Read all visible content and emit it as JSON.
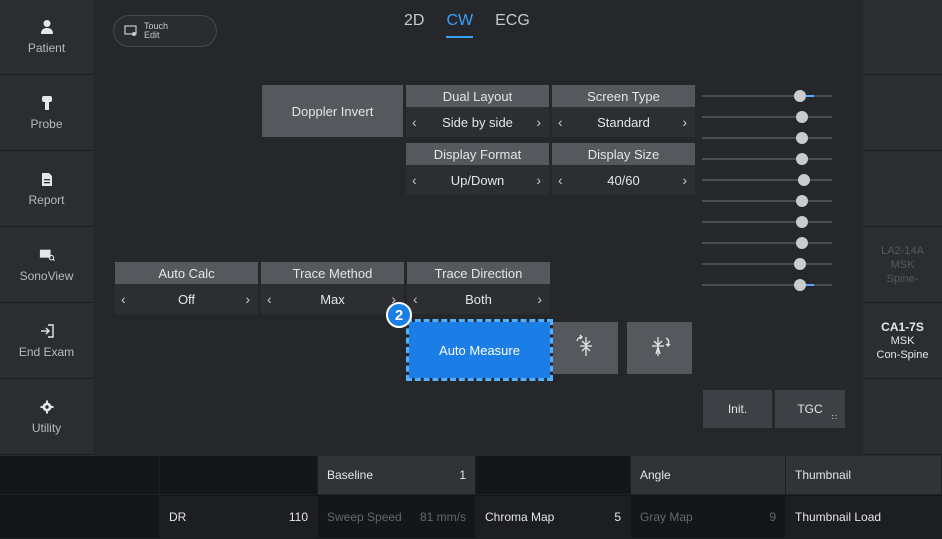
{
  "sidebar": {
    "items": [
      {
        "label": "Patient",
        "icon": "person-icon"
      },
      {
        "label": "Probe",
        "icon": "probe-icon"
      },
      {
        "label": "Report",
        "icon": "document-icon"
      },
      {
        "label": "SonoView",
        "icon": "image-search-icon"
      },
      {
        "label": "End Exam",
        "icon": "exit-icon"
      },
      {
        "label": "Utility",
        "icon": "gear-icon"
      }
    ]
  },
  "right_panel": {
    "probe1": {
      "line1": "LA2-14A",
      "line2": "MSK",
      "line3": "Spine-"
    },
    "probe2": {
      "line1": "CA1-7S",
      "line2": "MSK",
      "line3": "Con-Spine"
    }
  },
  "touch_edit": {
    "line1": "Touch",
    "line2": "Edit"
  },
  "tabs": [
    "2D",
    "CW",
    "ECG"
  ],
  "active_tab": "CW",
  "controls": {
    "doppler_invert": "Doppler Invert",
    "dual_layout": {
      "label": "Dual Layout",
      "value": "Side by side"
    },
    "screen_type": {
      "label": "Screen Type",
      "value": "Standard"
    },
    "display_format": {
      "label": "Display Format",
      "value": "Up/Down"
    },
    "display_size": {
      "label": "Display Size",
      "value": "40/60"
    },
    "auto_calc": {
      "label": "Auto Calc",
      "value": "Off"
    },
    "trace_method": {
      "label": "Trace Method",
      "value": "Max"
    },
    "trace_direction": {
      "label": "Trace Direction",
      "value": "Both"
    },
    "auto_measure": "Auto Measure",
    "badge": "2",
    "init": "Init.",
    "tgc": "TGC"
  },
  "tgc_sliders": [
    0.78,
    0.8,
    0.8,
    0.8,
    0.81,
    0.8,
    0.8,
    0.8,
    0.78,
    0.78
  ],
  "bottom": {
    "row1": [
      {
        "label": "",
        "value": ""
      },
      {
        "label": "",
        "value": ""
      },
      {
        "label": "Baseline",
        "value": "1"
      },
      {
        "label": "",
        "value": ""
      },
      {
        "label": "Angle",
        "value": ""
      },
      {
        "label": "Thumbnail",
        "value": ""
      }
    ],
    "row2": [
      {
        "label": "",
        "value": ""
      },
      {
        "label": "DR",
        "value": "110"
      },
      {
        "label": "Sweep Speed",
        "value": "81 mm/s"
      },
      {
        "label": "Chroma Map",
        "value": "5"
      },
      {
        "label": "Gray Map",
        "value": "9"
      },
      {
        "label": "Thumbnail Load",
        "value": ""
      }
    ]
  },
  "colors": {
    "accent": "#1a7ee6",
    "tab_active": "#3aa0ff",
    "button": "#55585c"
  }
}
